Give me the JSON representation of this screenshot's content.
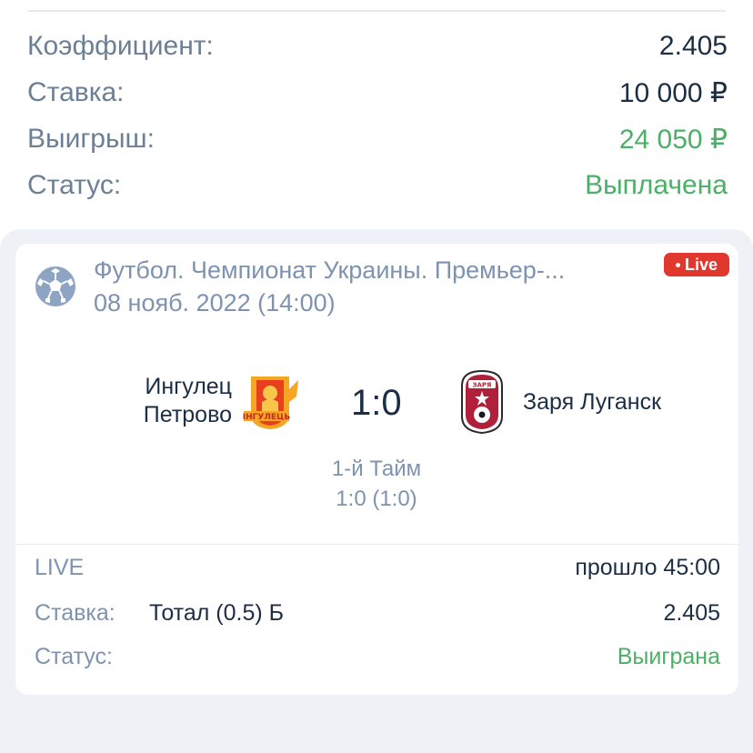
{
  "summary": {
    "coef_label": "Коэффициент:",
    "coef_value": "2.405",
    "stake_label": "Ставка:",
    "stake_value": "10 000 ₽",
    "win_label": "Выигрыш:",
    "win_value": "24 050 ₽",
    "status_label": "Статус:",
    "status_value": "Выплачена"
  },
  "event": {
    "league": "Футбол. Чемпионат Украины. Премьер-...",
    "date": "08 нояб. 2022 (14:00)",
    "live_badge": "Live",
    "sport_icon": "football-icon",
    "home_team_line1": "Ингулец",
    "home_team_line2": "Петрово",
    "home_logo": "ingulets-logo",
    "score": "1:0",
    "away_team": "Заря Луганск",
    "away_logo": "zorya-logo",
    "period": "1-й Тайм",
    "period_score": "1:0 (1:0)"
  },
  "details": {
    "mode_label": "LIVE",
    "elapsed": "прошло 45:00",
    "bet_label": "Ставка:",
    "bet_market": "Тотал (0.5) Б",
    "bet_coef": "2.405",
    "status_label": "Статус:",
    "status_value": "Выиграна"
  },
  "colors": {
    "green": "#4caf67",
    "muted": "#7d93b0",
    "dark": "#1b2e45",
    "live_red": "#e0382e",
    "background_gray": "#eef1f5"
  }
}
